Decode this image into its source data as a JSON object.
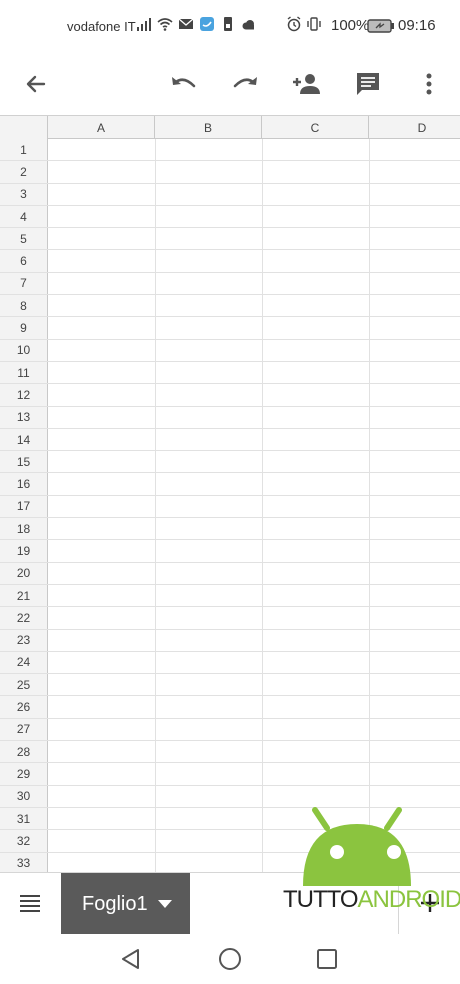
{
  "status_bar": {
    "carrier": "vodafone IT",
    "battery_percent": "100%",
    "time": "09:16"
  },
  "app_bar": {
    "icons": [
      "back-arrow-icon",
      "undo-icon",
      "redo-icon",
      "add-person-icon",
      "comment-icon",
      "more-vert-icon"
    ]
  },
  "sheet": {
    "columns": [
      "A",
      "B",
      "C",
      "D"
    ],
    "rows": [
      "1",
      "2",
      "3",
      "4",
      "5",
      "6",
      "7",
      "8",
      "9",
      "10",
      "11",
      "12",
      "13",
      "14",
      "15",
      "16",
      "17",
      "18",
      "19",
      "20",
      "21",
      "22",
      "23",
      "24",
      "25",
      "26",
      "27",
      "28",
      "29",
      "30",
      "31",
      "32",
      "33"
    ]
  },
  "tab_bar": {
    "sheet_tab_label": "Foglio1"
  },
  "watermark": {
    "part1": "TUTTO",
    "part2": "ANDROID",
    "green": "#8bc43f"
  }
}
